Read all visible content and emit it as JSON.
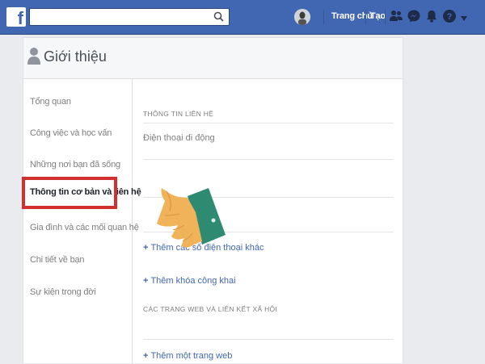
{
  "topbar": {
    "logo": "f",
    "search_placeholder": "",
    "search_value": "",
    "nav_home": "Trang chủ",
    "nav_create": "Tạo",
    "icons": [
      "friends-icon",
      "messenger-icon",
      "notifications-icon",
      "help-icon",
      "dropdown-icon"
    ]
  },
  "about": {
    "title": "Giới thiệu"
  },
  "sidebar": {
    "items": [
      {
        "label": "Tổng quan"
      },
      {
        "label": "Công việc và học vấn"
      },
      {
        "label": "Những nơi bạn đã sống"
      },
      {
        "label": "Thông tin cơ bản và liên hệ"
      },
      {
        "label": "Gia đình và các mối quan hệ"
      },
      {
        "label": "Chi tiết về bạn"
      },
      {
        "label": "Sự kiện trong đời"
      }
    ],
    "active_index": 3
  },
  "content": {
    "contact_section_title": "THÔNG TIN LIÊN HỆ",
    "mobile_label": "Điện thoại di động",
    "add_phone": "Thêm các số điện thoại khác",
    "add_public_key": "Thêm khóa công khai",
    "web_section_title": "CÁC TRANG WEB VÀ LIÊN KẾT XÃ HỘI",
    "add_website": "Thêm một trang web",
    "plus": "+"
  },
  "colors": {
    "brand": "#4267b2",
    "highlight": "#d32f2f",
    "hand_sleeve": "#2e8b72",
    "hand_skin": "#f0b35a"
  }
}
